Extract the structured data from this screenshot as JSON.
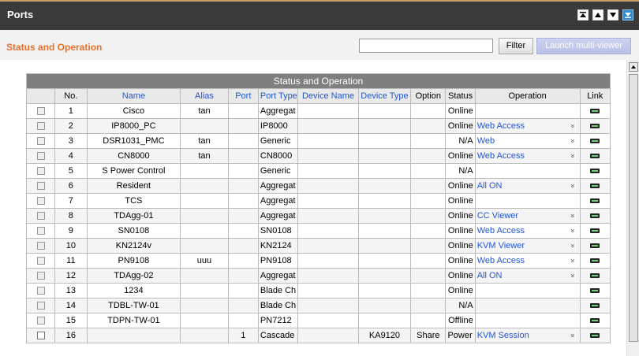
{
  "topbar": {
    "title": "Ports"
  },
  "subbar": {
    "title": "Status and Operation",
    "filter_placeholder": "",
    "filter_label": "Filter",
    "launch_label": "Launch multi-viewer"
  },
  "table": {
    "caption": "Status and Operation",
    "headers": {
      "no": "No.",
      "name": "Name",
      "alias": "Alias",
      "port": "Port",
      "port_type": "Port Type",
      "device_name": "Device Name",
      "device_type": "Device Type",
      "option": "Option",
      "status": "Status",
      "operation": "Operation",
      "link": "Link"
    },
    "rows": [
      {
        "no": "1",
        "name": "Cisco",
        "alias": "tan",
        "port": "",
        "port_type": "Aggregat",
        "device_name": "",
        "device_type": "",
        "option": "",
        "status": "Online",
        "operation": ""
      },
      {
        "no": "2",
        "name": "IP8000_PC",
        "alias": "",
        "port": "",
        "port_type": "IP8000",
        "device_name": "",
        "device_type": "",
        "option": "",
        "status": "Online",
        "operation": "Web Access"
      },
      {
        "no": "3",
        "name": "DSR1031_PMC",
        "alias": "tan",
        "port": "",
        "port_type": "Generic",
        "device_name": "",
        "device_type": "",
        "option": "",
        "status": "N/A",
        "operation": "Web"
      },
      {
        "no": "4",
        "name": "CN8000",
        "alias": "tan",
        "port": "",
        "port_type": "CN8000",
        "device_name": "",
        "device_type": "",
        "option": "",
        "status": "Online",
        "operation": "Web Access"
      },
      {
        "no": "5",
        "name": "S Power Control",
        "alias": "",
        "port": "",
        "port_type": "Generic",
        "device_name": "",
        "device_type": "",
        "option": "",
        "status": "N/A",
        "operation": ""
      },
      {
        "no": "6",
        "name": "Resident",
        "alias": "",
        "port": "",
        "port_type": "Aggregat",
        "device_name": "",
        "device_type": "",
        "option": "",
        "status": "Online",
        "operation": "All ON"
      },
      {
        "no": "7",
        "name": "TCS",
        "alias": "",
        "port": "",
        "port_type": "Aggregat",
        "device_name": "",
        "device_type": "",
        "option": "",
        "status": "Online",
        "operation": ""
      },
      {
        "no": "8",
        "name": "TDAgg-01",
        "alias": "",
        "port": "",
        "port_type": "Aggregat",
        "device_name": "",
        "device_type": "",
        "option": "",
        "status": "Online",
        "operation": "CC Viewer"
      },
      {
        "no": "9",
        "name": "SN0108",
        "alias": "",
        "port": "",
        "port_type": "SN0108",
        "device_name": "",
        "device_type": "",
        "option": "",
        "status": "Online",
        "operation": "Web Access"
      },
      {
        "no": "10",
        "name": "KN2124v",
        "alias": "",
        "port": "",
        "port_type": "KN2124",
        "device_name": "",
        "device_type": "",
        "option": "",
        "status": "Online",
        "operation": "KVM Viewer"
      },
      {
        "no": "11",
        "name": "PN9108",
        "alias": "uuu",
        "port": "",
        "port_type": "PN9108",
        "device_name": "",
        "device_type": "",
        "option": "",
        "status": "Online",
        "operation": "Web Access"
      },
      {
        "no": "12",
        "name": "TDAgg-02",
        "alias": "",
        "port": "",
        "port_type": "Aggregat",
        "device_name": "",
        "device_type": "",
        "option": "",
        "status": "Online",
        "operation": "All ON"
      },
      {
        "no": "13",
        "name": "1234",
        "alias": "",
        "port": "",
        "port_type": "Blade Ch",
        "device_name": "",
        "device_type": "",
        "option": "",
        "status": "Online",
        "operation": ""
      },
      {
        "no": "14",
        "name": "TDBL-TW-01",
        "alias": "",
        "port": "",
        "port_type": "Blade Ch",
        "device_name": "",
        "device_type": "",
        "option": "",
        "status": "N/A",
        "operation": ""
      },
      {
        "no": "15",
        "name": "TDPN-TW-01",
        "alias": "",
        "port": "",
        "port_type": "PN7212",
        "device_name": "",
        "device_type": "",
        "option": "",
        "status": "Offline",
        "operation": ""
      },
      {
        "no": "16",
        "name": "",
        "alias": "",
        "port": "1",
        "port_type": "Cascade",
        "device_name": "",
        "device_type": "KA9120",
        "option": "Share",
        "status": "Power O",
        "operation": "KVM Session"
      }
    ]
  },
  "icons": {
    "checkbox": "checkbox-icon",
    "link": "link-icon",
    "dropdown": "chevron-down-icon"
  }
}
